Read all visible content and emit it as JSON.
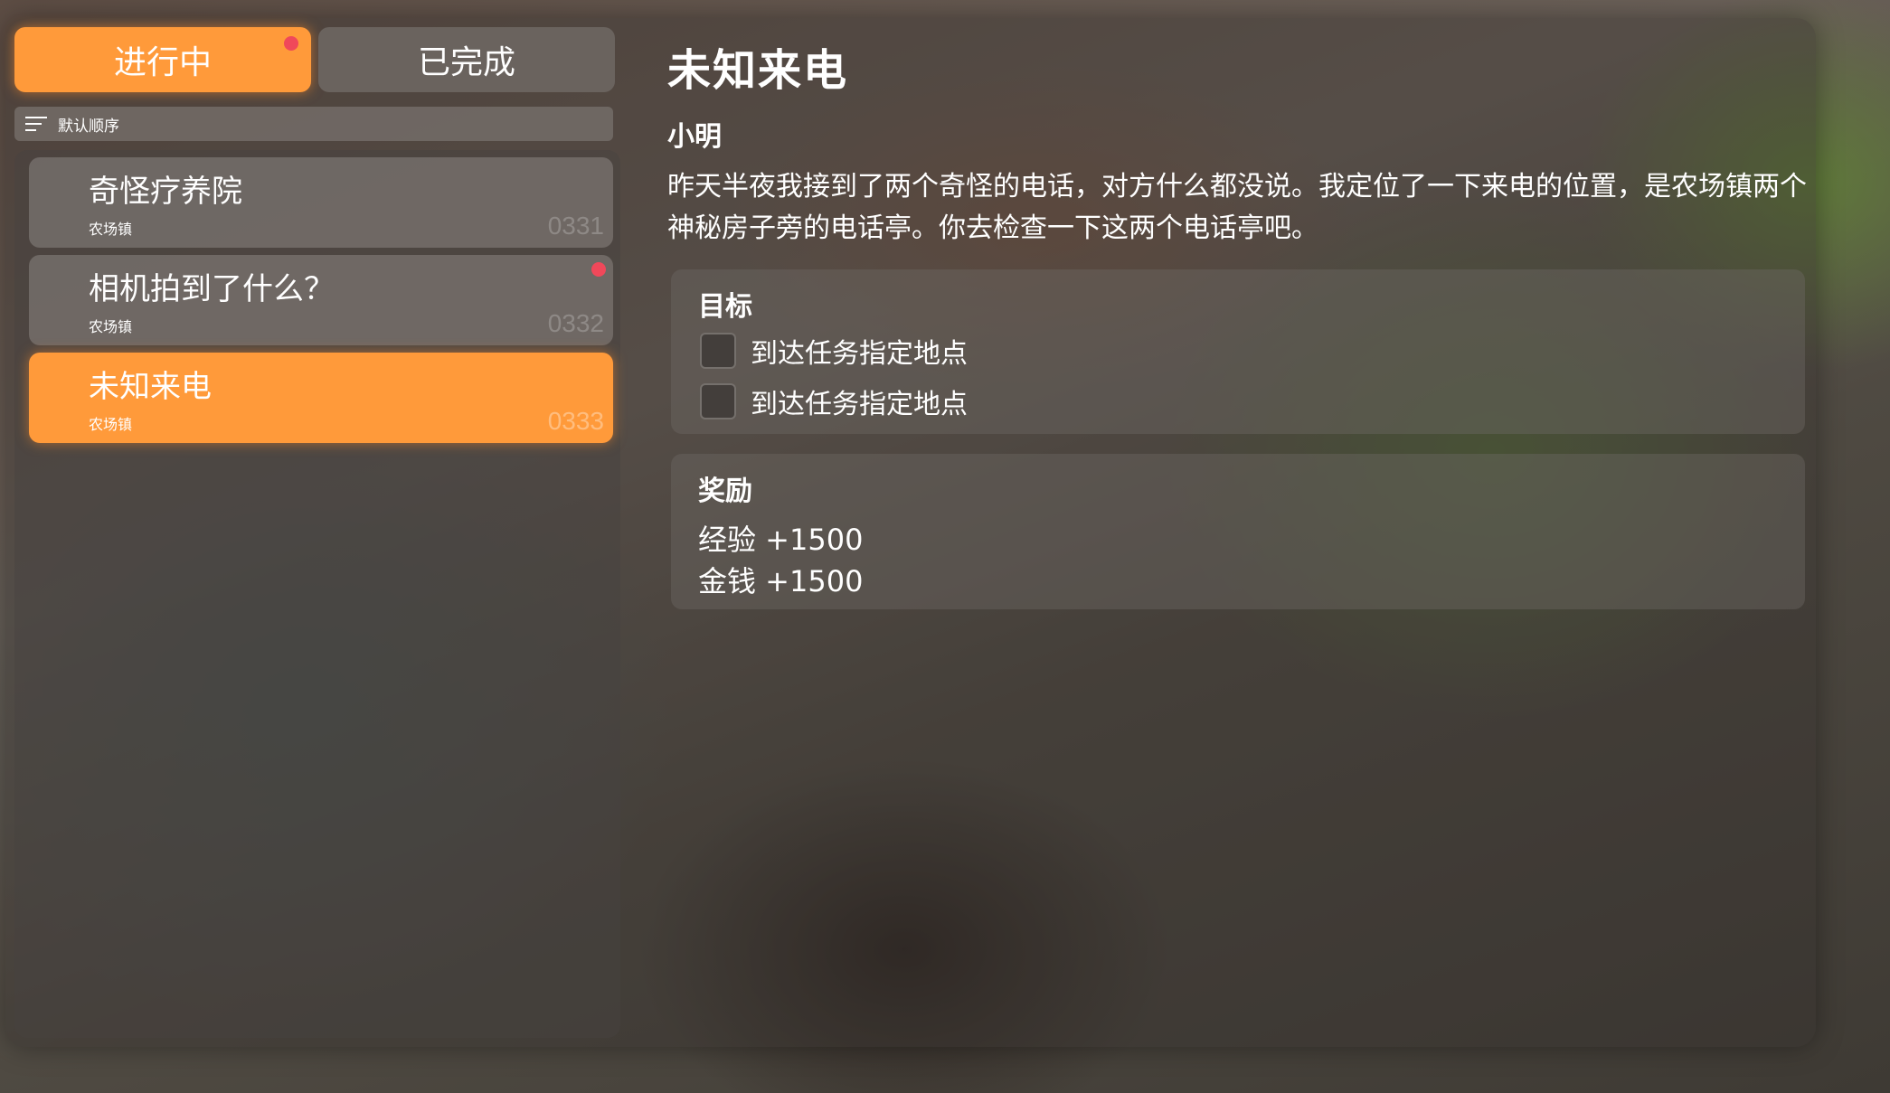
{
  "tabs": {
    "in_progress": "进行中",
    "completed": "已完成"
  },
  "sort": {
    "label": "默认顺序"
  },
  "quests": [
    {
      "title": "奇怪疗养院",
      "location": "农场镇",
      "id": "0331",
      "new": false
    },
    {
      "title": "相机拍到了什么？",
      "location": "农场镇",
      "id": "0332",
      "new": true
    },
    {
      "title": "未知来电",
      "location": "农场镇",
      "id": "0333",
      "new": false,
      "selected": true
    }
  ],
  "detail": {
    "title": "未知来电",
    "giver": "小明",
    "description": "昨天半夜我接到了两个奇怪的电话，对方什么都没说。我定位了一下来电的位置，是农场镇两个神秘房子旁的电话亭。你去检查一下这两个电话亭吧。",
    "objectives_heading": "目标",
    "objectives": [
      {
        "text": "到达任务指定地点",
        "done": false
      },
      {
        "text": "到达任务指定地点",
        "done": false
      }
    ],
    "rewards_heading": "奖励",
    "rewards": [
      "经验 +1500",
      "金钱 +1500"
    ]
  },
  "colors": {
    "accent": "#ff9a3a",
    "notification_dot": "#f0485a"
  }
}
